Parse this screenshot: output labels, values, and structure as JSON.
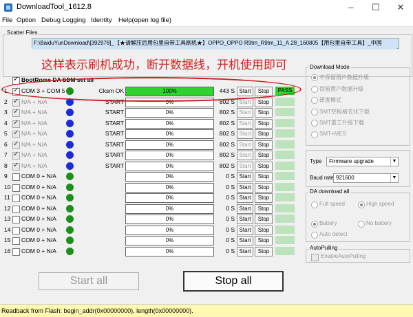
{
  "window": {
    "title": "DownloadTool_1612.8"
  },
  "menu": [
    "File",
    "Option",
    "Debug Logging",
    "Identity",
    "Help(open log file)"
  ],
  "scatter": {
    "label": "Scatter Files",
    "path": "F:\\BaiduYunDownload\\[392978]_【★请解压后用包里自带工具刷机★】OPPO_OPPO R9tm_R9tm_11_A.28_160805【用包里自带工具】_中国"
  },
  "overlay_text": "这样表示刷机成功，断开数据线，开机使用即可",
  "bootrom_label": "BootRome DA SDM set all",
  "rows": [
    {
      "num": "1",
      "checked": true,
      "port": "COM 3 + COM 5",
      "dot": "green",
      "status": "Cksm OK",
      "progress": 100,
      "pct": "100%",
      "time": "443 S",
      "start": "Start",
      "stop": "Stop",
      "result": "PASS",
      "enabled": true
    },
    {
      "num": "2",
      "checked": true,
      "port": "N/A + N/A",
      "dot": "blue",
      "status": "START",
      "progress": 0,
      "pct": "0%",
      "time": "802 S",
      "start": "Start",
      "stop": "Stop",
      "result": "",
      "enabled": false
    },
    {
      "num": "3",
      "checked": true,
      "port": "N/A + N/A",
      "dot": "blue",
      "status": "START",
      "progress": 0,
      "pct": "0%",
      "time": "802 S",
      "start": "Start",
      "stop": "Stop",
      "result": "",
      "enabled": false
    },
    {
      "num": "4",
      "checked": true,
      "port": "N/A + N/A",
      "dot": "blue",
      "status": "START",
      "progress": 0,
      "pct": "0%",
      "time": "802 S",
      "start": "Start",
      "stop": "Stop",
      "result": "",
      "enabled": false
    },
    {
      "num": "5",
      "checked": true,
      "port": "N/A + N/A",
      "dot": "blue",
      "status": "START",
      "progress": 0,
      "pct": "0%",
      "time": "802 S",
      "start": "Start",
      "stop": "Stop",
      "result": "",
      "enabled": false
    },
    {
      "num": "6",
      "checked": true,
      "port": "N/A + N/A",
      "dot": "blue",
      "status": "START",
      "progress": 0,
      "pct": "0%",
      "time": "802 S",
      "start": "Start",
      "stop": "Stop",
      "result": "",
      "enabled": false
    },
    {
      "num": "7",
      "checked": true,
      "port": "N/A + N/A",
      "dot": "blue",
      "status": "START",
      "progress": 0,
      "pct": "0%",
      "time": "802 S",
      "start": "Start",
      "stop": "Stop",
      "result": "",
      "enabled": false
    },
    {
      "num": "8",
      "checked": true,
      "port": "N/A + N/A",
      "dot": "blue",
      "status": "START",
      "progress": 0,
      "pct": "0%",
      "time": "802 S",
      "start": "Start",
      "stop": "Stop",
      "result": "",
      "enabled": false
    },
    {
      "num": "9",
      "checked": false,
      "port": "COM 0 + N/A",
      "dot": "green",
      "status": "",
      "progress": 0,
      "pct": "0%",
      "time": "0 S",
      "start": "Start",
      "stop": "Stop",
      "result": "",
      "enabled": true
    },
    {
      "num": "10",
      "checked": false,
      "port": "COM 0 + N/A",
      "dot": "green",
      "status": "",
      "progress": 0,
      "pct": "0%",
      "time": "0 S",
      "start": "Start",
      "stop": "Stop",
      "result": "",
      "enabled": true
    },
    {
      "num": "11",
      "checked": false,
      "port": "COM 0 + N/A",
      "dot": "green",
      "status": "",
      "progress": 0,
      "pct": "0%",
      "time": "0 S",
      "start": "Start",
      "stop": "Stop",
      "result": "",
      "enabled": true
    },
    {
      "num": "12",
      "checked": false,
      "port": "COM 0 + N/A",
      "dot": "green",
      "status": "",
      "progress": 0,
      "pct": "0%",
      "time": "0 S",
      "start": "Start",
      "stop": "Stop",
      "result": "",
      "enabled": true
    },
    {
      "num": "13",
      "checked": false,
      "port": "COM 0 + N/A",
      "dot": "green",
      "status": "",
      "progress": 0,
      "pct": "0%",
      "time": "0 S",
      "start": "Start",
      "stop": "Stop",
      "result": "",
      "enabled": true
    },
    {
      "num": "14",
      "checked": false,
      "port": "COM 0 + N/A",
      "dot": "green",
      "status": "",
      "progress": 0,
      "pct": "0%",
      "time": "0 S",
      "start": "Start",
      "stop": "Stop",
      "result": "",
      "enabled": true
    },
    {
      "num": "15",
      "checked": false,
      "port": "COM 0 + N/A",
      "dot": "green",
      "status": "",
      "progress": 0,
      "pct": "0%",
      "time": "0 S",
      "start": "Start",
      "stop": "Stop",
      "result": "",
      "enabled": true
    },
    {
      "num": "16",
      "checked": false,
      "port": "COM 0 + N/A",
      "dot": "green",
      "status": "",
      "progress": 0,
      "pct": "0%",
      "time": "0 S",
      "start": "Start",
      "stop": "Stop",
      "result": "",
      "enabled": true
    }
  ],
  "download_mode": {
    "title": "Download Mode",
    "options": [
      "不保留用户数据升级",
      "保留用户数据升级",
      "研发模式",
      "SMT空板格式化下载",
      "SMT重工升级下载",
      "SMT+MES"
    ],
    "selected": 0
  },
  "type": {
    "label": "Type",
    "value": "Firmware upgrade"
  },
  "baud": {
    "label": "Baud rate",
    "value": "921600"
  },
  "da_download": {
    "title": "DA download all",
    "full_speed": "Full speed",
    "high_speed": "High speed",
    "battery": "Battery",
    "no_battery": "No battery",
    "auto_detect": "Auto detect"
  },
  "auto_pulling": {
    "title": "AutoPulling",
    "checkbox": "EnableAutoPulling"
  },
  "buttons": {
    "start_all": "Start all",
    "stop_all": "Stop all"
  },
  "status_bar": "Readback from Flash:  begin_addr(0x00000000), length(0x00000000)."
}
